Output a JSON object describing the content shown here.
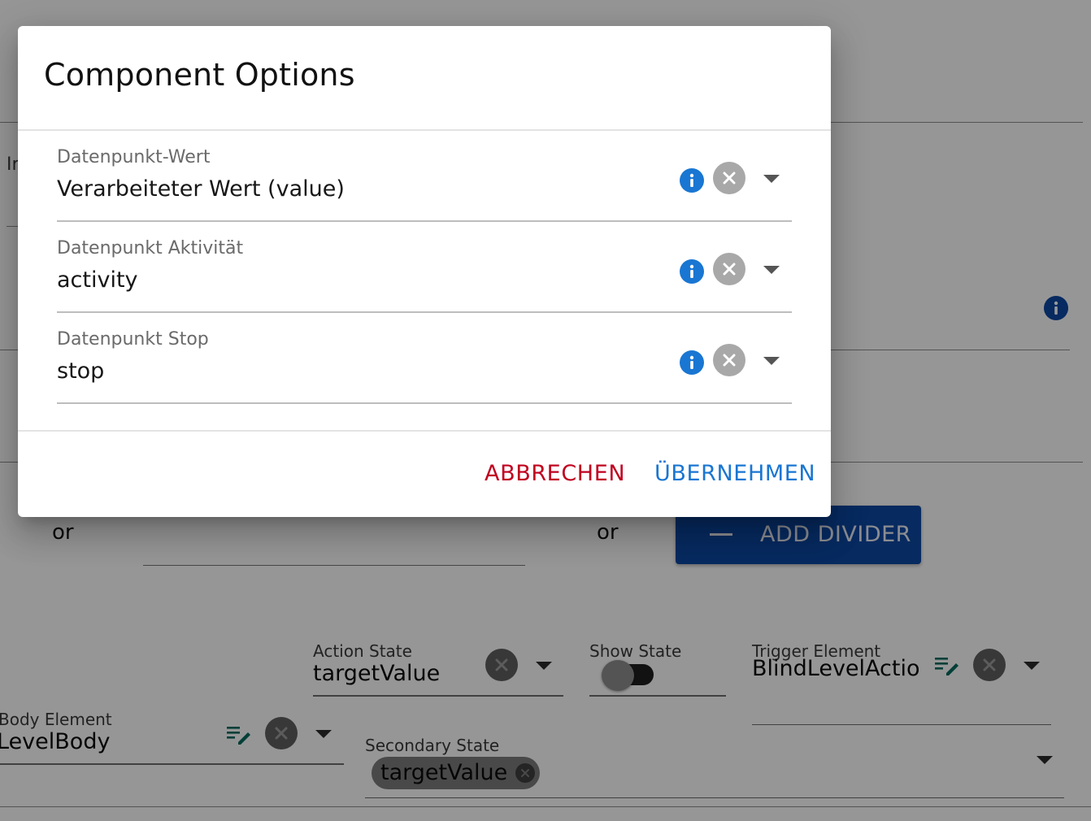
{
  "background": {
    "left_label_fragment": "Ir",
    "or_label_1": "or",
    "or_label_2": "or",
    "add_divider_label": "ADD DIVIDER",
    "action_state": {
      "label": "Action State",
      "value": "targetValue"
    },
    "show_state": {
      "label": "Show State"
    },
    "trigger_element": {
      "label": "Trigger Element",
      "value": "BlindLevelActior"
    },
    "body_element": {
      "label": "Body Element",
      "value": "LevelBody"
    },
    "secondary_state": {
      "label": "Secondary State",
      "chip": "targetValue"
    }
  },
  "dialog": {
    "title": "Component Options",
    "fields": [
      {
        "label": "Datenpunkt-Wert",
        "value": "Verarbeiteter Wert (value)"
      },
      {
        "label": "Datenpunkt Aktivität",
        "value": "activity"
      },
      {
        "label": "Datenpunkt Stop",
        "value": "stop"
      }
    ],
    "cancel_label": "ABBRECHEN",
    "apply_label": "ÜBERNEHMEN"
  },
  "colors": {
    "primary": "#1976d2",
    "cancel": "#c0001f",
    "overlay": "rgba(0,0,0,0.40)"
  }
}
